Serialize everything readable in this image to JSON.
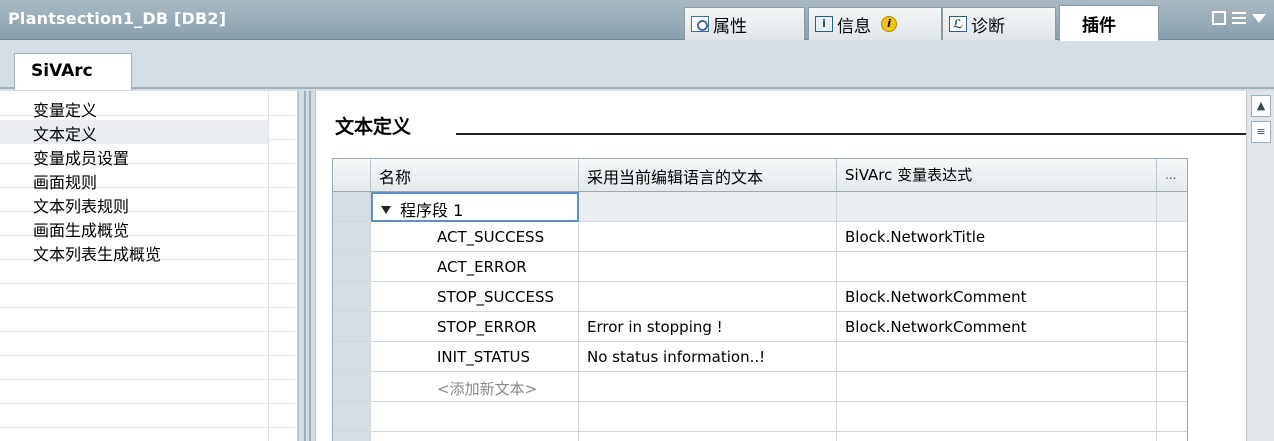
{
  "header": {
    "title": "Plantsection1_DB [DB2]",
    "tabs": [
      {
        "label": "属性",
        "icon": "properties-icon"
      },
      {
        "label": "信息",
        "icon": "info-icon"
      },
      {
        "label": "诊断",
        "icon": "diagnostics-icon"
      },
      {
        "label": "插件",
        "icon": ""
      }
    ]
  },
  "tab_row": {
    "active_tab": "SiVArc"
  },
  "nav": {
    "items": [
      {
        "label": "变量定义"
      },
      {
        "label": "文本定义"
      },
      {
        "label": "变量成员设置"
      },
      {
        "label": "画面规则"
      },
      {
        "label": "文本列表规则"
      },
      {
        "label": "画面生成概览"
      },
      {
        "label": "文本列表生成概览"
      }
    ],
    "selected_index": 1
  },
  "main": {
    "section_title": "文本定义"
  },
  "table": {
    "columns": [
      "名称",
      "采用当前编辑语言的文本",
      "SiVArc 变量表达式",
      "..."
    ],
    "group": "程序段 1",
    "rows": [
      {
        "name": "ACT_SUCCESS",
        "text": "",
        "expression": "Block.NetworkTitle"
      },
      {
        "name": "ACT_ERROR",
        "text": "",
        "expression": ""
      },
      {
        "name": "STOP_SUCCESS",
        "text": "",
        "expression": "Block.NetworkComment"
      },
      {
        "name": "STOP_ERROR",
        "text": "Error in stopping !",
        "expression": "Block.NetworkComment"
      },
      {
        "name": "INIT_STATUS",
        "text": "No status information..!",
        "expression": ""
      }
    ],
    "add_placeholder": "<添加新文本>"
  },
  "colors": {
    "titlebar": "#8aa0ad",
    "selection_border": "#5b8fc7",
    "info_badge": "#f1c40f"
  }
}
